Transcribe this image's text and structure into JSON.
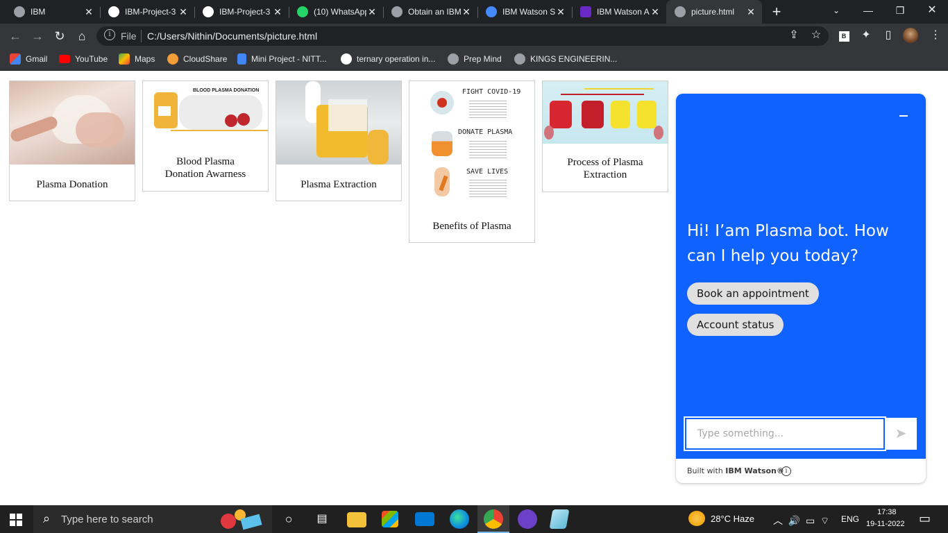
{
  "browser": {
    "tabs": [
      {
        "title": "IBM",
        "favicon": "ibm-globe-icon",
        "active": false
      },
      {
        "title": "IBM-Project-3",
        "favicon": "github-icon",
        "active": false
      },
      {
        "title": "IBM-Project-3",
        "favicon": "github-icon",
        "active": false
      },
      {
        "title": "(10) WhatsApp",
        "favicon": "whatsapp-icon",
        "active": false
      },
      {
        "title": "Obtain an IBM",
        "favicon": "globe-icon",
        "active": false
      },
      {
        "title": "IBM Watson S",
        "favicon": "watson-cloud-icon",
        "active": false
      },
      {
        "title": "IBM Watson A",
        "favicon": "watson-assistant-icon",
        "active": false
      },
      {
        "title": "picture.html",
        "favicon": "globe-icon",
        "active": true
      }
    ],
    "new_tab_label": "+",
    "address": {
      "scheme_label": "File",
      "url": "C:/Users/Nithin/Documents/picture.html"
    },
    "bookmarks": [
      {
        "label": "Gmail",
        "icon": "gmail-icon"
      },
      {
        "label": "YouTube",
        "icon": "youtube-icon"
      },
      {
        "label": "Maps",
        "icon": "maps-icon"
      },
      {
        "label": "CloudShare",
        "icon": "cloudshare-icon"
      },
      {
        "label": "Mini Project - NITT...",
        "icon": "docs-icon"
      },
      {
        "label": "ternary operation in...",
        "icon": "google-icon"
      },
      {
        "label": "Prep Mind",
        "icon": "globe-icon"
      },
      {
        "label": "KINGS ENGINEERIN...",
        "icon": "globe-icon"
      }
    ]
  },
  "gallery": {
    "cards": [
      {
        "caption": "Plasma Donation"
      },
      {
        "caption": "Blood Plasma Donation Awarness",
        "image_title": "BLOOD PLASMA DONATION"
      },
      {
        "caption": "Plasma Extraction"
      },
      {
        "caption": "Benefits of Plasma",
        "poster_lines": [
          "FIGHT COVID-19",
          "DONATE PLASMA",
          "SAVE LIVES"
        ]
      },
      {
        "caption": "Process of Plasma Extraction"
      }
    ]
  },
  "chat": {
    "greeting": "Hi! I’am Plasma bot. How can I help you today?",
    "options": [
      "Book an appointment",
      "Account status"
    ],
    "input_placeholder": "Type something...",
    "footer_prefix": "Built with",
    "footer_brand": "IBM Watson®",
    "accent": "#0f62fe"
  },
  "taskbar": {
    "search_placeholder": "Type here to search",
    "weather": "28°C  Haze",
    "language": "ENG",
    "time": "17:38",
    "date": "19-11-2022"
  }
}
